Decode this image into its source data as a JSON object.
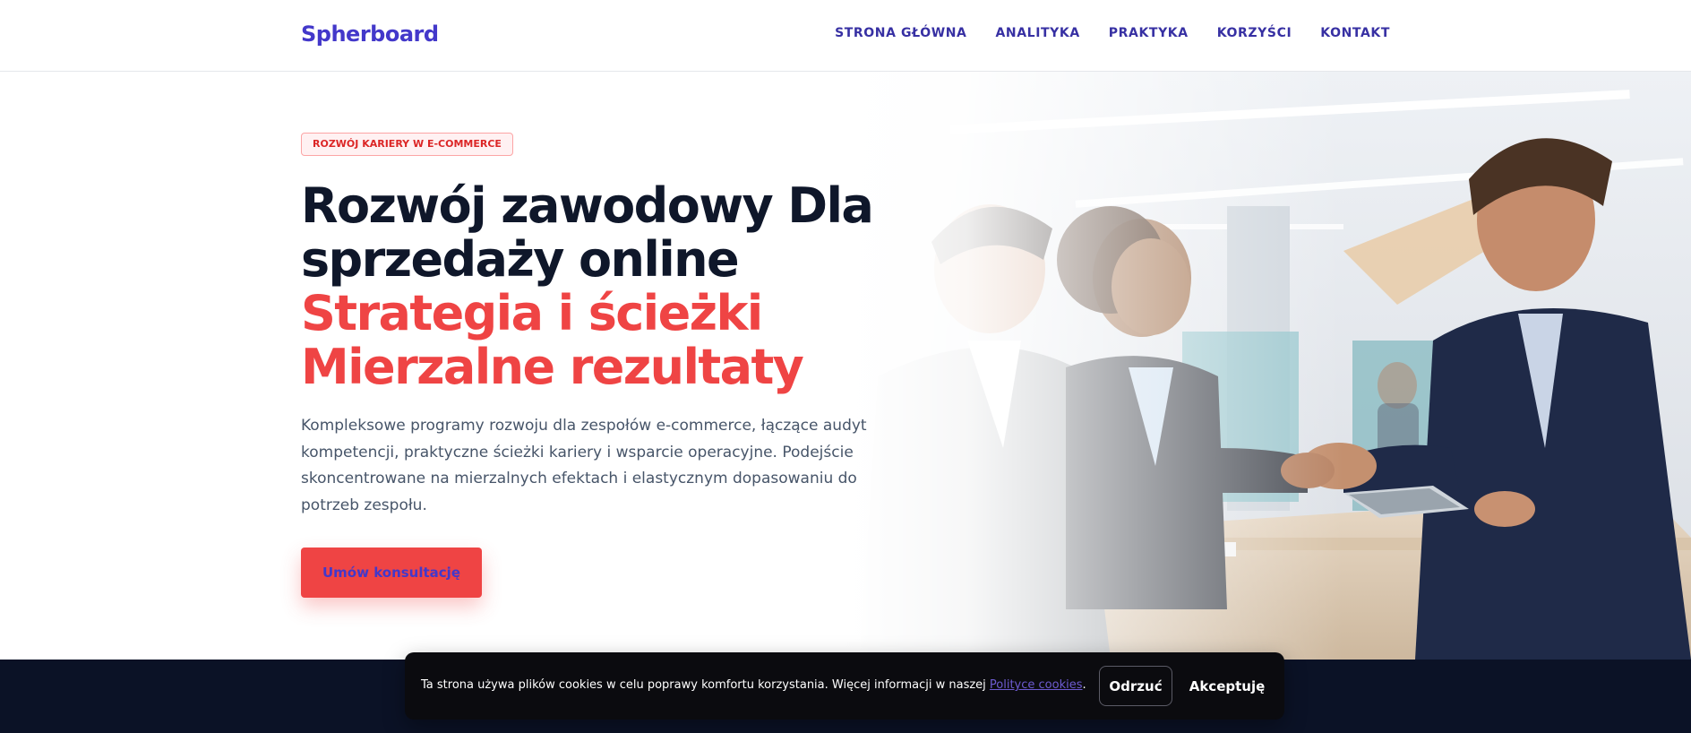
{
  "header": {
    "logo": "Spherboard",
    "nav": [
      {
        "label": "STRONA GŁÓWNA"
      },
      {
        "label": "ANALITYKA"
      },
      {
        "label": "PRAKTYKA"
      },
      {
        "label": "KORZYŚCI"
      },
      {
        "label": "KONTAKT"
      }
    ]
  },
  "hero": {
    "badge": "ROZWÓJ KARIERY W E-COMMERCE",
    "title_line1": "Rozwój zawodowy Dla",
    "title_line2": "sprzedaży online",
    "title_line3": "Strategia i ścieżki",
    "title_line4": "Mierzalne rezultaty",
    "lead": "Kompleksowe programy rozwoju dla zespołów e-commerce, łączące audyt kompetencji, praktyczne ścieżki kariery i wsparcie operacyjne. Podejście skoncentrowane na mierzalnych efektach i elastycznym dopasowaniu do potrzeb zespołu.",
    "cta": "Umów konsultację"
  },
  "cookie": {
    "text": "Ta strona używa plików cookies w celu poprawy komfortu korzystania. Więcej informacji w naszej ",
    "link": "Polityce cookies",
    "period": ".",
    "reject": "Odrzuć",
    "accept": "Akceptuję"
  },
  "colors": {
    "brand": "#4338ca",
    "accent": "#ef4444",
    "dark": "#0f172a",
    "footer": "#0b1226"
  }
}
